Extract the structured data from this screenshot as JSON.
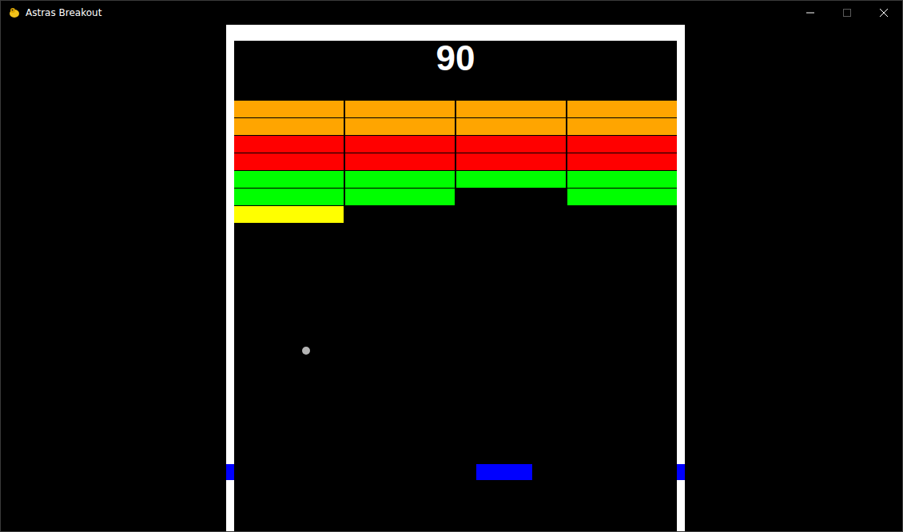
{
  "window": {
    "title": "Astras Breakout"
  },
  "score": "90",
  "bricks": [
    {
      "color": "#ffa500",
      "cells": [
        true,
        true,
        true,
        true
      ]
    },
    {
      "color": "#ffa500",
      "cells": [
        true,
        true,
        true,
        true
      ]
    },
    {
      "color": "#ff0000",
      "cells": [
        true,
        true,
        true,
        true
      ]
    },
    {
      "color": "#ff0000",
      "cells": [
        true,
        true,
        true,
        true
      ]
    },
    {
      "color": "#00ff00",
      "cells": [
        true,
        true,
        true,
        true
      ]
    },
    {
      "color": "#00ff00",
      "cells": [
        true,
        true,
        false,
        true
      ]
    },
    {
      "color": "#ffff00",
      "cells": [
        true,
        false,
        false,
        false
      ]
    }
  ]
}
